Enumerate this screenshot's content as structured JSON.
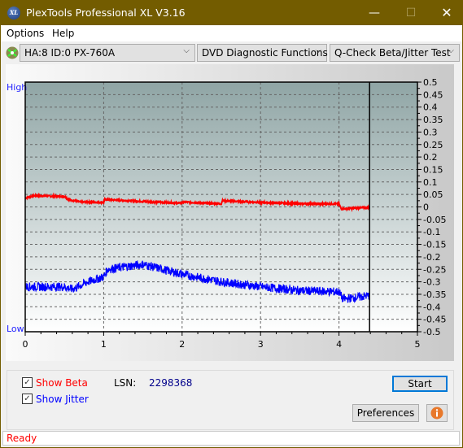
{
  "window": {
    "title": "PlexTools Professional XL V3.16",
    "logo": "XL",
    "minimize_icon": "minimize-icon",
    "maximize_icon": "maximize-icon",
    "close_icon": "close-icon"
  },
  "menu": [
    {
      "label": "Options",
      "accel": "O"
    },
    {
      "label": "Help",
      "accel": "H"
    }
  ],
  "toolbar": {
    "drive": "HA:8 ID:0  PX-760A",
    "function": "DVD Diagnostic Functions",
    "test": "Q-Check Beta/Jitter Test"
  },
  "chart_data": {
    "type": "line",
    "left_labels": {
      "high": "High",
      "low": "Low"
    },
    "xlim": [
      0,
      5
    ],
    "ylim": [
      -0.5,
      0.5
    ],
    "x_ticks": [
      "0",
      "1",
      "2",
      "3",
      "4",
      "5"
    ],
    "y_ticks": [
      "0.5",
      "0.45",
      "0.4",
      "0.35",
      "0.3",
      "0.25",
      "0.2",
      "0.15",
      "0.1",
      "0.05",
      "0",
      "-0.05",
      "-0.1",
      "-0.15",
      "-0.2",
      "-0.25",
      "-0.3",
      "-0.35",
      "-0.4",
      "-0.45",
      "-0.5"
    ],
    "grid": true,
    "cursor_x": 4.39,
    "series": [
      {
        "name": "Beta",
        "color": "#ff0000",
        "x": [
          0,
          0.1,
          0.5,
          0.55,
          0.7,
          1.0,
          1.01,
          1.5,
          2.0,
          2.01,
          2.5,
          2.51,
          3.0,
          3.5,
          4.0,
          4.03,
          4.39
        ],
        "y": [
          0.035,
          0.045,
          0.042,
          0.03,
          0.02,
          0.018,
          0.03,
          0.022,
          0.015,
          0.02,
          0.012,
          0.025,
          0.018,
          0.013,
          0.012,
          -0.008,
          -0.002
        ]
      },
      {
        "name": "Jitter",
        "color": "#0000ff",
        "x": [
          0,
          0.5,
          0.6,
          0.8,
          1.0,
          1.05,
          1.5,
          2.0,
          2.5,
          3.0,
          3.5,
          4.0,
          4.05,
          4.39
        ],
        "y": [
          -0.32,
          -0.32,
          -0.33,
          -0.3,
          -0.28,
          -0.25,
          -0.23,
          -0.27,
          -0.3,
          -0.32,
          -0.335,
          -0.34,
          -0.37,
          -0.355
        ]
      }
    ]
  },
  "controls": {
    "show_beta": "Show Beta",
    "show_jitter": "Show Jitter",
    "lsn_label": "LSN:",
    "lsn_value": "2298368",
    "start": "Start",
    "preferences": "Preferences",
    "info_icon": "info-icon"
  },
  "status": "Ready"
}
